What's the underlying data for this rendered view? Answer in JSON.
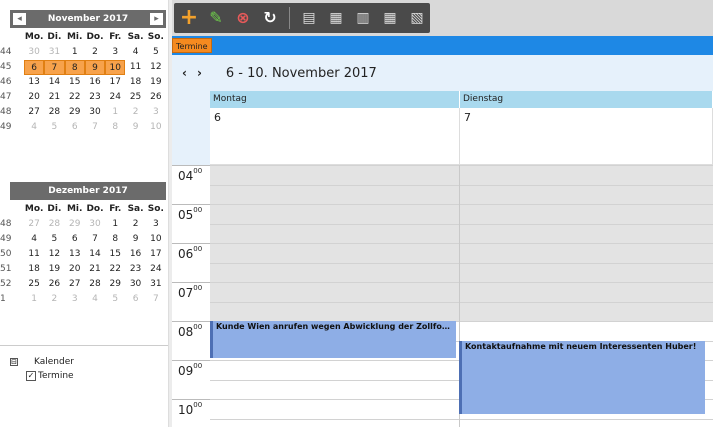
{
  "calendar_nov": {
    "title": "November 2017",
    "weekdays": [
      "Mo.",
      "Di.",
      "Mi.",
      "Do.",
      "Fr.",
      "Sa.",
      "So."
    ],
    "rows": [
      {
        "week": "44",
        "days": [
          "30",
          "31",
          "1",
          "2",
          "3",
          "4",
          "5"
        ]
      },
      {
        "week": "45",
        "days": [
          "6",
          "7",
          "8",
          "9",
          "10",
          "11",
          "12"
        ]
      },
      {
        "week": "46",
        "days": [
          "13",
          "14",
          "15",
          "16",
          "17",
          "18",
          "19"
        ]
      },
      {
        "week": "47",
        "days": [
          "20",
          "21",
          "22",
          "23",
          "24",
          "25",
          "26"
        ]
      },
      {
        "week": "48",
        "days": [
          "27",
          "28",
          "29",
          "30",
          "1",
          "2",
          "3"
        ]
      },
      {
        "week": "49",
        "days": [
          "4",
          "5",
          "6",
          "7",
          "8",
          "9",
          "10"
        ]
      }
    ]
  },
  "calendar_dec": {
    "title": "Dezember 2017",
    "weekdays": [
      "Mo.",
      "Di.",
      "Mi.",
      "Do.",
      "Fr.",
      "Sa.",
      "So."
    ],
    "rows": [
      {
        "week": "48",
        "days": [
          "27",
          "28",
          "29",
          "30",
          "1",
          "2",
          "3"
        ]
      },
      {
        "week": "49",
        "days": [
          "4",
          "5",
          "6",
          "7",
          "8",
          "9",
          "10"
        ]
      },
      {
        "week": "50",
        "days": [
          "11",
          "12",
          "13",
          "14",
          "15",
          "16",
          "17"
        ]
      },
      {
        "week": "51",
        "days": [
          "18",
          "19",
          "20",
          "21",
          "22",
          "23",
          "24"
        ]
      },
      {
        "week": "52",
        "days": [
          "25",
          "26",
          "27",
          "28",
          "29",
          "30",
          "31"
        ]
      },
      {
        "week": "1",
        "days": [
          "1",
          "2",
          "3",
          "4",
          "5",
          "6",
          "7"
        ]
      }
    ]
  },
  "tree": {
    "root_label": "Kalender",
    "root_toggle": "⊟",
    "child_label": "Termine",
    "child_check": "✓"
  },
  "toolbar": {
    "add_icon": "plus-icon",
    "edit_icon": "pencil-icon",
    "delete_icon": "trash-icon",
    "refresh_icon": "refresh-icon"
  },
  "tab": {
    "label": "Termine"
  },
  "datebar": {
    "prev": "‹",
    "next": "›",
    "range": "6 - 10. November 2017"
  },
  "columns": [
    {
      "name": "Montag",
      "day": "6"
    },
    {
      "name": "Dienstag",
      "day": "7"
    }
  ],
  "hours": [
    "04",
    "05",
    "06",
    "07",
    "08",
    "09",
    "10"
  ],
  "hour_suffix": "00",
  "events": [
    {
      "title": "Kunde Wien anrufen wegen Abwicklung der Zollform..."
    },
    {
      "title": "Kontaktaufnahme mit neuem Interessenten Huber!"
    }
  ],
  "colors": {
    "accent": "#1e88e5",
    "selected_day": "#f7a24b",
    "event": "#8eaee6",
    "tab": "#f58a1f"
  }
}
